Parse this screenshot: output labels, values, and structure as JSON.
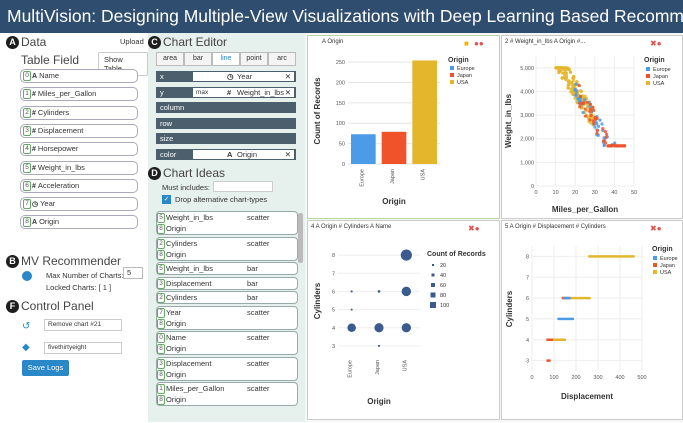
{
  "app": {
    "title": "MultiVision: Designing Multiple-View Visualizations with Deep Learning Based Recommendation"
  },
  "badges": {
    "a": "A",
    "b": "B",
    "c": "C",
    "d": "D",
    "e": "E",
    "f": "F"
  },
  "data_panel": {
    "title": "Data",
    "upload": "Upload",
    "table_field": "Table Field",
    "show_table": "Show Table",
    "fields": [
      {
        "n": "0",
        "icon": "A",
        "name": "Name"
      },
      {
        "n": "1",
        "icon": "#",
        "name": "Miles_per_Gallon"
      },
      {
        "n": "2",
        "icon": "#",
        "name": "Cylinders"
      },
      {
        "n": "3",
        "icon": "#",
        "name": "Displacement"
      },
      {
        "n": "4",
        "icon": "#",
        "name": "Horsepower"
      },
      {
        "n": "5",
        "icon": "#",
        "name": "Weight_in_lbs"
      },
      {
        "n": "6",
        "icon": "#",
        "name": "Acceleration"
      },
      {
        "n": "7",
        "icon": "◷",
        "name": "Year"
      },
      {
        "n": "8",
        "icon": "A",
        "name": "Origin"
      }
    ]
  },
  "recommender": {
    "title": "MV Recommender",
    "max_label": "Max Number of Charts:",
    "max_value": "5",
    "locked": "Locked Charts: [ 1 ]"
  },
  "control": {
    "title": "Control Panel",
    "remove": "Remove chart #21",
    "theme": "fivethirtyeight",
    "save": "Save Logs"
  },
  "editor": {
    "title": "Chart Editor",
    "marks": [
      "area",
      "bar",
      "line",
      "point",
      "arc"
    ],
    "encodings": [
      {
        "ch": "x",
        "agg": "",
        "icon": "◷",
        "field": "Year"
      },
      {
        "ch": "y",
        "agg": "max",
        "icon": "#",
        "field": "Weight_in_lbs"
      },
      {
        "ch": "column",
        "agg": "",
        "icon": "",
        "field": ""
      },
      {
        "ch": "row",
        "agg": "",
        "icon": "",
        "field": ""
      },
      {
        "ch": "size",
        "agg": "",
        "icon": "",
        "field": ""
      },
      {
        "ch": "color",
        "agg": "",
        "icon": "A",
        "field": "Origin"
      }
    ]
  },
  "ideas": {
    "title": "Chart Ideas",
    "must": "Must includes:",
    "drop": "Drop alternative chart-types",
    "items": [
      {
        "rows": [
          {
            "n": "5",
            "f": "Weight_in_lbs"
          },
          {
            "n": "8",
            "f": "Origin"
          }
        ],
        "type": "scatter"
      },
      {
        "rows": [
          {
            "n": "2",
            "f": "Cylinders"
          },
          {
            "n": "8",
            "f": "Origin"
          }
        ],
        "type": "scatter"
      },
      {
        "rows": [
          {
            "n": "5",
            "f": "Weight_in_lbs"
          }
        ],
        "type": "bar"
      },
      {
        "rows": [
          {
            "n": "3",
            "f": "Displacement"
          }
        ],
        "type": "bar"
      },
      {
        "rows": [
          {
            "n": "2",
            "f": "Cylinders"
          }
        ],
        "type": "bar"
      },
      {
        "rows": [
          {
            "n": "7",
            "f": "Year"
          },
          {
            "n": "8",
            "f": "Origin"
          }
        ],
        "type": "scatter"
      },
      {
        "rows": [
          {
            "n": "0",
            "f": "Name"
          },
          {
            "n": "8",
            "f": "Origin"
          }
        ],
        "type": "scatter"
      },
      {
        "rows": [
          {
            "n": "3",
            "f": "Displacement"
          },
          {
            "n": "8",
            "f": "Origin"
          }
        ],
        "type": "scatter"
      },
      {
        "rows": [
          {
            "n": "1",
            "f": "Miles_per_Gallon"
          },
          {
            "n": "8",
            "f": "Origin"
          }
        ],
        "type": "scatter"
      }
    ]
  },
  "charts": {
    "c1": {
      "title": "A Origin",
      "xlabel": "Origin",
      "ylabel": "Count of Records",
      "legend_title": "Origin"
    },
    "c2": {
      "title": "2 # Weight_in_lbs  A Origin  #...",
      "xlabel": "Miles_per_Gallon",
      "ylabel": "Weight_in_lbs",
      "legend_title": "Origin"
    },
    "c4": {
      "title": "4 A Origin  # Cylinders  A Name",
      "xlabel": "Origin",
      "ylabel": "Cylinders",
      "legend_title": "Count of Records"
    },
    "c5": {
      "title": "5 A Origin  # Displacement  # Cylinders",
      "xlabel": "Displacement",
      "ylabel": "Cylinders",
      "legend_title": "Origin"
    }
  },
  "chart_data": [
    {
      "type": "bar",
      "categories": [
        "Europe",
        "Japan",
        "USA"
      ],
      "values": [
        73,
        79,
        254
      ],
      "ylim": [
        0,
        260
      ],
      "yticks": [
        0,
        50,
        100,
        150,
        200,
        250
      ],
      "xlabel": "Origin",
      "ylabel": "Count of Records",
      "legend": [
        "Europe",
        "Japan",
        "USA"
      ],
      "colors": {
        "Europe": "#4c9be8",
        "Japan": "#f0522a",
        "USA": "#e3b62b"
      }
    },
    {
      "type": "scatter",
      "xlabel": "Miles_per_Gallon",
      "ylabel": "Weight_in_lbs",
      "xlim": [
        0,
        50
      ],
      "ylim": [
        0,
        5500
      ],
      "xticks": [
        0,
        10,
        20,
        30,
        40,
        50
      ],
      "yticks": [
        0,
        1000,
        2000,
        3000,
        4000,
        5000
      ],
      "legend": [
        "Europe",
        "Japan",
        "USA"
      ],
      "colors": {
        "Europe": "#4c9be8",
        "Japan": "#f0522a",
        "USA": "#e3b62b"
      }
    },
    {
      "type": "scatter",
      "xlabel": "Origin",
      "ylabel": "Cylinders",
      "categories": [
        "Europe",
        "Japan",
        "USA"
      ],
      "yticks": [
        3,
        4,
        5,
        6,
        7,
        8
      ],
      "points": [
        {
          "x": "Europe",
          "y": 4,
          "size": 60
        },
        {
          "x": "Europe",
          "y": 5,
          "size": 3
        },
        {
          "x": "Europe",
          "y": 6,
          "size": 4
        },
        {
          "x": "Japan",
          "y": 3,
          "size": 4
        },
        {
          "x": "Japan",
          "y": 4,
          "size": 69
        },
        {
          "x": "Japan",
          "y": 6,
          "size": 6
        },
        {
          "x": "USA",
          "y": 4,
          "size": 72
        },
        {
          "x": "USA",
          "y": 6,
          "size": 74
        },
        {
          "x": "USA",
          "y": 8,
          "size": 103
        }
      ],
      "legend_sizes": [
        20,
        40,
        60,
        80,
        100
      ]
    },
    {
      "type": "scatter",
      "xlabel": "Displacement",
      "ylabel": "Cylinders",
      "xlim": [
        0,
        500
      ],
      "xticks": [
        0,
        100,
        200,
        300,
        400,
        500
      ],
      "yticks": [
        3,
        4,
        5,
        6,
        7,
        8
      ],
      "legend": [
        "Europe",
        "Japan",
        "USA"
      ],
      "colors": {
        "Europe": "#4c9be8",
        "Japan": "#f0522a",
        "USA": "#e3b62b"
      }
    }
  ]
}
